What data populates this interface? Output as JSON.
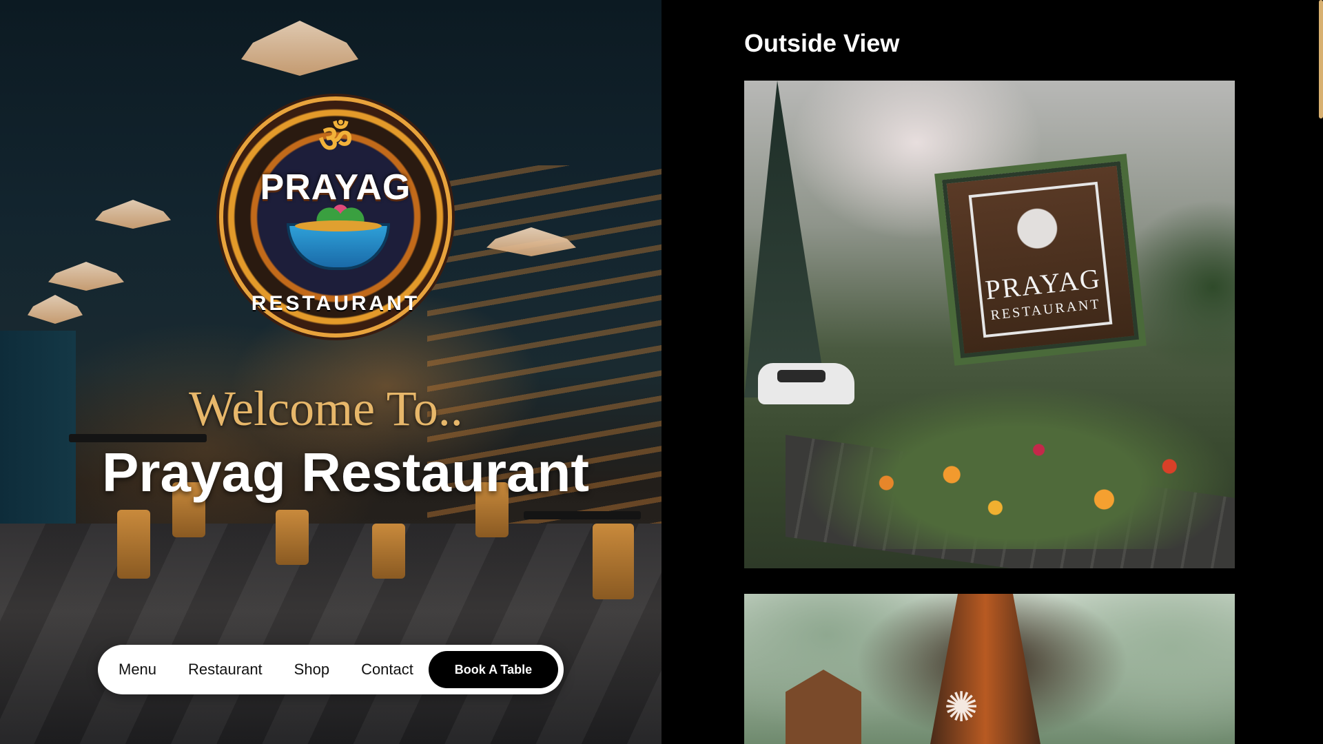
{
  "hero": {
    "logo": {
      "top_glyph": "ॐ",
      "title": "PRAYAG",
      "subtitle": "RESTAURANT",
      "accent": "#e8a33c"
    },
    "welcome": "Welcome To..",
    "title": "Prayag Restaurant",
    "welcome_color": "#e7b76a"
  },
  "nav": {
    "items": [
      {
        "label": "Menu"
      },
      {
        "label": "Restaurant"
      },
      {
        "label": "Shop"
      },
      {
        "label": "Contact"
      }
    ],
    "book_label": "Book A Table"
  },
  "gallery": {
    "title": "Outside View",
    "photos": [
      {
        "sign_title": "PRAYAG",
        "sign_subtitle": "RESTAURANT"
      },
      {}
    ]
  },
  "colors": {
    "accent_gold": "#e7b76a",
    "scrollbar": "#d8b070",
    "background": "#000000"
  }
}
